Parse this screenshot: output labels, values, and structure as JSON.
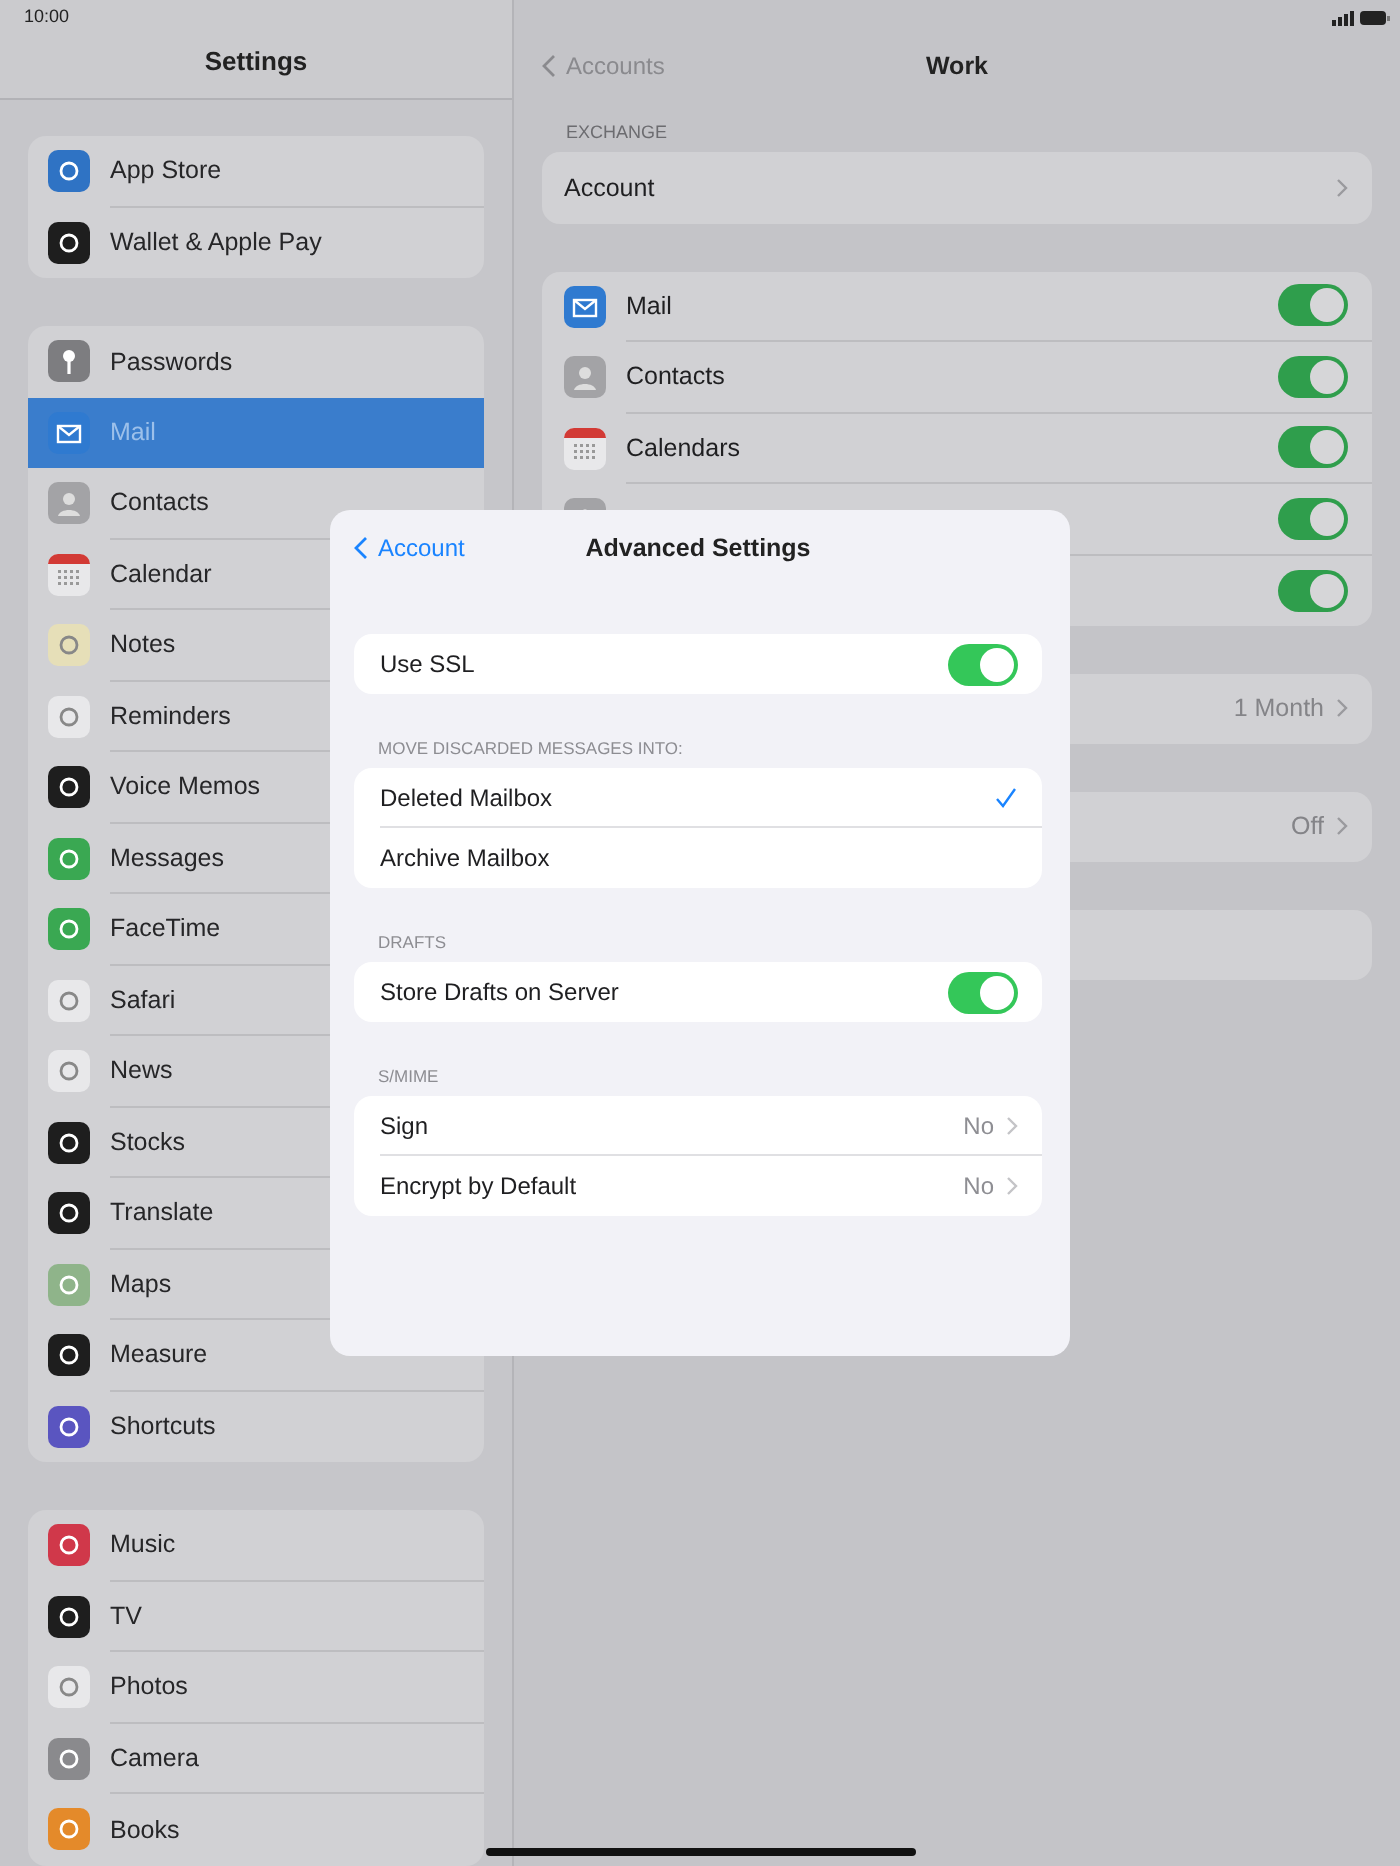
{
  "status_bar": {
    "time": "10:00"
  },
  "sidebar": {
    "title": "Settings",
    "groups": [
      {
        "items": [
          {
            "label": "App Store",
            "selected": false
          },
          {
            "label": "Wallet & Apple Pay",
            "selected": false
          }
        ]
      },
      {
        "items": [
          {
            "label": "Passwords",
            "selected": false
          },
          {
            "label": "Mail",
            "selected": true
          },
          {
            "label": "Contacts",
            "selected": false
          },
          {
            "label": "Calendar",
            "selected": false
          },
          {
            "label": "Notes",
            "selected": false
          },
          {
            "label": "Reminders",
            "selected": false
          },
          {
            "label": "Voice Memos",
            "selected": false
          },
          {
            "label": "Messages",
            "selected": false
          },
          {
            "label": "FaceTime",
            "selected": false
          },
          {
            "label": "Safari",
            "selected": false
          },
          {
            "label": "News",
            "selected": false
          },
          {
            "label": "Stocks",
            "selected": false
          },
          {
            "label": "Translate",
            "selected": false
          },
          {
            "label": "Maps",
            "selected": false
          },
          {
            "label": "Measure",
            "selected": false
          },
          {
            "label": "Shortcuts",
            "selected": false
          }
        ]
      },
      {
        "items": [
          {
            "label": "Music",
            "selected": false
          },
          {
            "label": "TV",
            "selected": false
          },
          {
            "label": "Photos",
            "selected": false
          },
          {
            "label": "Camera",
            "selected": false
          },
          {
            "label": "Books",
            "selected": false
          }
        ]
      }
    ]
  },
  "detail": {
    "back": "Accounts",
    "title": "Work",
    "sections": [
      {
        "header": "EXCHANGE",
        "rows": [
          {
            "kind": "link",
            "label": "Account"
          }
        ]
      },
      {
        "rows": [
          {
            "kind": "toggle",
            "label": "Mail",
            "on": true
          },
          {
            "kind": "toggle",
            "label": "Contacts",
            "on": true
          },
          {
            "kind": "toggle",
            "label": "Calendars",
            "on": true
          },
          {
            "kind": "toggle",
            "on": true
          },
          {
            "kind": "toggle",
            "on": true
          }
        ]
      },
      {
        "rows": [
          {
            "kind": "link",
            "value": "1 Month"
          }
        ]
      },
      {
        "rows": [
          {
            "kind": "link",
            "value": "Off"
          }
        ]
      },
      {
        "rows": [
          {
            "kind": "plain"
          }
        ]
      }
    ]
  },
  "dialog": {
    "back": "Account",
    "title": "Advanced Settings",
    "sections": [
      {
        "rows": [
          {
            "kind": "toggle",
            "label": "Use SSL",
            "on": true
          }
        ]
      },
      {
        "header": "MOVE DISCARDED MESSAGES INTO:",
        "rows": [
          {
            "kind": "choice",
            "label": "Deleted Mailbox",
            "selected": true
          },
          {
            "kind": "choice",
            "label": "Archive Mailbox",
            "selected": false
          }
        ]
      },
      {
        "header": "DRAFTS",
        "rows": [
          {
            "kind": "toggle",
            "label": "Store Drafts on Server",
            "on": true
          }
        ]
      },
      {
        "header": "S/MIME",
        "rows": [
          {
            "kind": "link",
            "label": "Sign",
            "value": "No"
          },
          {
            "kind": "link",
            "label": "Encrypt by Default",
            "value": "No"
          }
        ]
      }
    ]
  }
}
